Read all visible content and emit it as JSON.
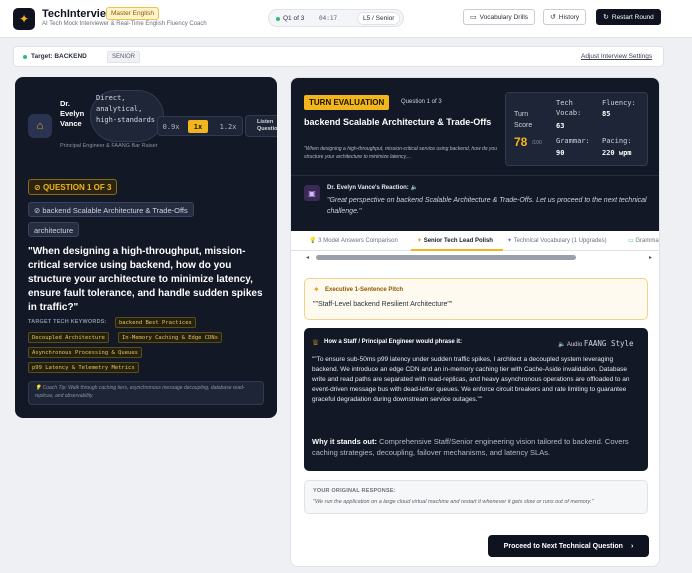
{
  "header": {
    "app_title": "TechInterview",
    "badge": "Master English",
    "subtitle": "AI Tech Mock Interviewer & Real-Time English Fluency Coach",
    "progress": "Q1 of 3",
    "timer": "04:17",
    "level": "L5 / Senior",
    "vocab_btn": "Vocabulary Drills",
    "history_btn": "History",
    "restart_btn": "Restart Round"
  },
  "target_bar": {
    "target": "Target: BACKEND",
    "seniority": "SENIOR",
    "adjust": "Adjust Interview Settings"
  },
  "interviewer": {
    "name": "Dr. Evelyn Vance",
    "style": "Direct, analytical, high-standards",
    "role": "Principal Engineer & FAANG Bar Raiser",
    "speeds": [
      "0.9x",
      "1x",
      "1.2x"
    ],
    "active_speed": "1x",
    "listen": "Listen Question"
  },
  "question": {
    "tag": "QUESTION 1 OF 3",
    "topic": "backend Scalable Architecture & Trade-Offs",
    "category": "architecture",
    "text": "\"When designing a high-throughput, mission-critical service using backend, how do you structure your architecture to minimize latency, ensure fault tolerance, and handle sudden spikes in traffic?\"",
    "keywords_label": "TARGET TECH KEYWORDS:",
    "keywords": [
      "backend Best Practices",
      "Decoupled Architecture",
      "In-Memory Caching & Edge CDNs",
      "Asynchronous Processing & Queues",
      "p99 Latency & Telemetry Metrics"
    ],
    "tip": "Coach Tip: Walk through caching tiers, asynchronous message decoupling, database read-replicas, and observability."
  },
  "evaluation": {
    "tag": "TURN EVALUATION",
    "question_of": "Question 1 of 3",
    "title": "backend Scalable Architecture & Trade-Offs",
    "question_snippet": "\"When designing a high-throughput, mission-critical service using backend, how do you structure your architecture to minimize latency,...",
    "turn_score_label": "Turn Score",
    "turn_score": "78",
    "turn_score_max": "/100",
    "tech_vocab_label": "Tech Vocab:",
    "tech_vocab": "63",
    "fluency_label": "Fluency:",
    "fluency": "85",
    "grammar_label": "Grammar:",
    "grammar": "90",
    "pacing_label": "Pacing:",
    "pacing": "220 wpm",
    "reaction_label": "Dr. Evelyn Vance's Reaction:",
    "reaction": "\"Great perspective on backend Scalable Architecture & Trade-Offs. Let us proceed to the next technical challenge.\""
  },
  "tabs": [
    {
      "label": "3 Model Answers Comparison"
    },
    {
      "label": "Senior Tech Lead Polish"
    },
    {
      "label": "Technical Vocabulary (1 Upgrades)"
    },
    {
      "label": "Gramma"
    }
  ],
  "pitch": {
    "label": "Executive 1-Sentence Pitch",
    "text": "\"\"Staff-Level backend Resilient Architecture\"\""
  },
  "staff": {
    "label": "How a Staff / Principal Engineer would phrase it:",
    "audio": "Audio",
    "audio_style": "FAANG Style",
    "text": "\"\"To ensure sub-50ms p99 latency under sudden traffic spikes, I architect a decoupled system leveraging backend. We introduce an edge CDN and an in-memory caching tier with Cache-Aside invalidation. Database write and read paths are separated with read-replicas, and heavy asynchronous operations are offloaded to an event-driven message bus with dead-letter queues. We enforce circuit breakers and rate limiting to guarantee graceful degradation during downstream service outages.\"\"",
    "why_label": "Why it stands out:",
    "why": "Comprehensive Staff/Senior engineering vision tailored to backend. Covers caching strategies, decoupling, failover mechanisms, and latency SLAs."
  },
  "original": {
    "label": "YOUR ORIGINAL RESPONSE:",
    "text": "\"We run the application on a large cloud virtual machine and restart it whenever it gets slow or runs out of memory.\""
  },
  "proceed": "Proceed to Next Technical Question",
  "colors": {
    "accent": "#f2b61c",
    "dark": "#131826",
    "success": "#2bbf74"
  }
}
